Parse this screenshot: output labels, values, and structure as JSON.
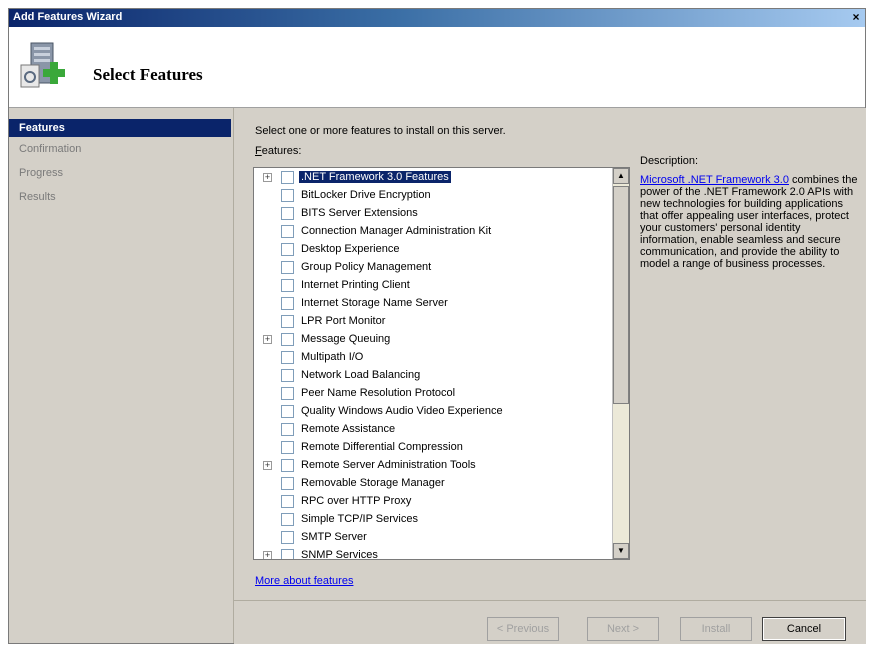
{
  "window": {
    "title": "Add Features Wizard",
    "close_glyph": "×"
  },
  "header": {
    "heading": "Select Features",
    "icon": "server-add-icon"
  },
  "steps": [
    {
      "label": "Features",
      "active": true
    },
    {
      "label": "Confirmation",
      "active": false
    },
    {
      "label": "Progress",
      "active": false
    },
    {
      "label": "Results",
      "active": false
    }
  ],
  "main": {
    "instruction": "Select one or more features to install on this server.",
    "features_label_underlined": "F",
    "features_label_rest": "eatures:",
    "features": [
      {
        "label": ".NET Framework 3.0 Features",
        "expandable": true,
        "selected": true
      },
      {
        "label": "BitLocker Drive Encryption",
        "expandable": false
      },
      {
        "label": "BITS Server Extensions",
        "expandable": false
      },
      {
        "label": "Connection Manager Administration Kit",
        "expandable": false
      },
      {
        "label": "Desktop Experience",
        "expandable": false
      },
      {
        "label": "Group Policy Management",
        "expandable": false
      },
      {
        "label": "Internet Printing Client",
        "expandable": false
      },
      {
        "label": "Internet Storage Name Server",
        "expandable": false
      },
      {
        "label": "LPR Port Monitor",
        "expandable": false
      },
      {
        "label": "Message Queuing",
        "expandable": true
      },
      {
        "label": "Multipath I/O",
        "expandable": false
      },
      {
        "label": "Network Load Balancing",
        "expandable": false
      },
      {
        "label": "Peer Name Resolution Protocol",
        "expandable": false
      },
      {
        "label": "Quality Windows Audio Video Experience",
        "expandable": false
      },
      {
        "label": "Remote Assistance",
        "expandable": false
      },
      {
        "label": "Remote Differential Compression",
        "expandable": false
      },
      {
        "label": "Remote Server Administration Tools",
        "expandable": true
      },
      {
        "label": "Removable Storage Manager",
        "expandable": false
      },
      {
        "label": "RPC over HTTP Proxy",
        "expandable": false
      },
      {
        "label": "Simple TCP/IP Services",
        "expandable": false
      },
      {
        "label": "SMTP Server",
        "expandable": false
      },
      {
        "label": "SNMP Services",
        "expandable": true
      }
    ],
    "description_label": "Description:",
    "description_link": "Microsoft .NET Framework 3.0",
    "description_text": "combines the power of the .NET Framework 2.0 APIs with new technologies for building applications that offer appealing user interfaces, protect your customers' personal identity information, enable seamless and secure communication, and provide the ability to model a range of business processes.",
    "more_link": "More about features"
  },
  "buttons": {
    "previous": "< Previous",
    "next": "Next >",
    "install": "Install",
    "cancel": "Cancel"
  },
  "colors": {
    "selection": "#0a246a",
    "link": "#0000ee",
    "face": "#d4d0c8"
  }
}
